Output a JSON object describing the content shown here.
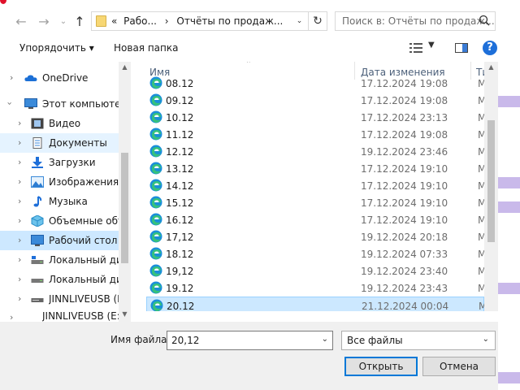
{
  "addressbar": {
    "path_prefix": "«",
    "path_segment_1": "Рабо...",
    "path_separator": "›",
    "path_segment_2": "Отчёты по продаж...",
    "search_placeholder": "Поиск в: Отчёты по продаж..."
  },
  "toolbar": {
    "organize_label": "Упорядочить ▾",
    "new_folder_label": "Новая папка"
  },
  "nav": {
    "items": [
      {
        "label": "OneDrive",
        "icon": "cloud-icon"
      },
      {
        "label": "Этот компьютер",
        "icon": "computer-icon"
      },
      {
        "label": "Видео",
        "icon": "video-icon"
      },
      {
        "label": "Документы",
        "icon": "documents-icon"
      },
      {
        "label": "Загрузки",
        "icon": "downloads-icon"
      },
      {
        "label": "Изображения",
        "icon": "pictures-icon"
      },
      {
        "label": "Музыка",
        "icon": "music-icon"
      },
      {
        "label": "Объемные объ",
        "icon": "3d-objects-icon"
      },
      {
        "label": "Рабочий стол",
        "icon": "desktop-icon"
      },
      {
        "label": "Локальный дис",
        "icon": "local-disk-icon"
      },
      {
        "label": "Локальный дис",
        "icon": "drive-icon"
      },
      {
        "label": "JINNLIVEUSB (E:)",
        "icon": "usb-drive-icon"
      },
      {
        "label": "JINNLIVEUSB (E:)",
        "icon": "usb-drive-icon"
      }
    ]
  },
  "columns": {
    "name": "Имя",
    "date": "Дата изменения",
    "type": "Тип"
  },
  "files": [
    {
      "name": "08.12",
      "date": "17.12.2024 19:08",
      "type": "Micr"
    },
    {
      "name": "09.12",
      "date": "17.12.2024 19:08",
      "type": "Micr"
    },
    {
      "name": "10.12",
      "date": "17.12.2024 23:13",
      "type": "Micr"
    },
    {
      "name": "11.12",
      "date": "17.12.2024 19:08",
      "type": "Micr"
    },
    {
      "name": "12.12",
      "date": "19.12.2024 23:46",
      "type": "Micr"
    },
    {
      "name": "13.12",
      "date": "17.12.2024 19:10",
      "type": "Micr"
    },
    {
      "name": "14.12",
      "date": "17.12.2024 19:10",
      "type": "Micr"
    },
    {
      "name": "15.12",
      "date": "17.12.2024 19:10",
      "type": "Micr"
    },
    {
      "name": "16.12",
      "date": "17.12.2024 19:10",
      "type": "Micr"
    },
    {
      "name": "17,12",
      "date": "19.12.2024 20:18",
      "type": "Micr"
    },
    {
      "name": "18.12",
      "date": "19.12.2024 07:33",
      "type": "Micr"
    },
    {
      "name": "19,12",
      "date": "19.12.2024 23:40",
      "type": "Micr"
    },
    {
      "name": "19.12",
      "date": "19.12.2024 23:43",
      "type": "Micr"
    },
    {
      "name": "20.12",
      "date": "21.12.2024 00:04",
      "type": "Micr"
    }
  ],
  "bottom": {
    "filename_label": "Имя файла:",
    "filename_value": "20,12",
    "filetype_value": "Все файлы",
    "open_label": "Открыть",
    "cancel_label": "Отмена"
  },
  "colors": {
    "selection": "#cce8ff",
    "accent": "#0078d7",
    "background_app": "#c9b9ea"
  }
}
